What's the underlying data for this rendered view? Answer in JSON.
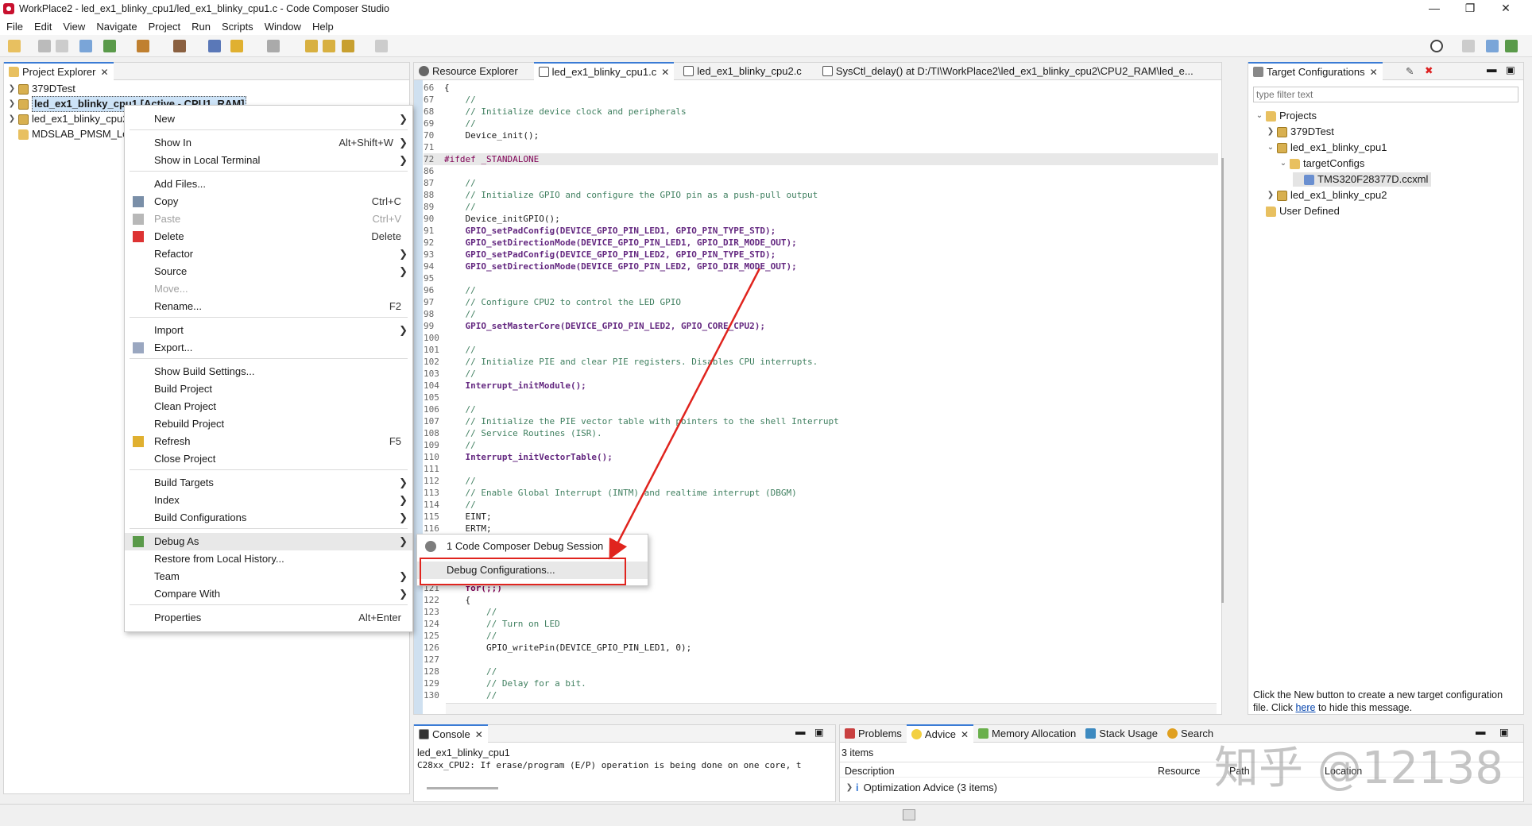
{
  "window": {
    "title": "WorkPlace2 - led_ex1_blinky_cpu1/led_ex1_blinky_cpu1.c - Code Composer Studio",
    "minimize": "—",
    "maximize": "❐",
    "close": "✕"
  },
  "menubar": [
    "File",
    "Edit",
    "View",
    "Navigate",
    "Project",
    "Run",
    "Scripts",
    "Window",
    "Help"
  ],
  "project_explorer": {
    "tab_label": "Project Explorer",
    "items": [
      {
        "label": "379DTest"
      },
      {
        "label": "led_ex1_blinky_cpu1  [Active - CPU1_RAM]"
      },
      {
        "label": "led_ex1_blinky_cpu2"
      },
      {
        "label": "MDSLAB_PMSM_Lo"
      }
    ]
  },
  "context_menu": {
    "items": [
      {
        "label": "New",
        "accel": "",
        "submenu": true
      },
      {
        "label": "Show In",
        "accel": "Alt+Shift+W",
        "submenu": true
      },
      {
        "label": "Show in Local Terminal",
        "accel": "",
        "submenu": true
      },
      {
        "label": "Add Files...",
        "accel": ""
      },
      {
        "label": "Copy",
        "accel": "Ctrl+C"
      },
      {
        "label": "Paste",
        "accel": "Ctrl+V",
        "disabled": true
      },
      {
        "label": "Delete",
        "accel": "Delete"
      },
      {
        "label": "Refactor",
        "accel": "",
        "submenu": true
      },
      {
        "label": "Source",
        "accel": "",
        "submenu": true
      },
      {
        "label": "Move...",
        "accel": "",
        "disabled": true
      },
      {
        "label": "Rename...",
        "accel": "F2"
      },
      {
        "label": "Import",
        "accel": "",
        "submenu": true
      },
      {
        "label": "Export...",
        "accel": ""
      },
      {
        "label": "Show Build Settings...",
        "accel": ""
      },
      {
        "label": "Build Project",
        "accel": ""
      },
      {
        "label": "Clean Project",
        "accel": ""
      },
      {
        "label": "Rebuild Project",
        "accel": ""
      },
      {
        "label": "Refresh",
        "accel": "F5"
      },
      {
        "label": "Close Project",
        "accel": ""
      },
      {
        "label": "Build Targets",
        "accel": "",
        "submenu": true
      },
      {
        "label": "Index",
        "accel": "",
        "submenu": true
      },
      {
        "label": "Build Configurations",
        "accel": "",
        "submenu": true
      },
      {
        "label": "Debug As",
        "accel": "",
        "submenu": true
      },
      {
        "label": "Restore from Local History...",
        "accel": ""
      },
      {
        "label": "Team",
        "accel": "",
        "submenu": true
      },
      {
        "label": "Compare With",
        "accel": "",
        "submenu": true
      },
      {
        "label": "Properties",
        "accel": "Alt+Enter"
      }
    ]
  },
  "debug_submenu": {
    "items": [
      {
        "label": "1 Code Composer Debug Session"
      },
      {
        "label": "Debug Configurations..."
      }
    ]
  },
  "editor": {
    "tabs": [
      {
        "label": "Resource Explorer"
      },
      {
        "label": "led_ex1_blinky_cpu1.c"
      },
      {
        "label": "led_ex1_blinky_cpu2.c"
      },
      {
        "label": "SysCtl_delay() at D:/TI\\WorkPlace2\\led_ex1_blinky_cpu2\\CPU2_RAM\\led_e..."
      }
    ],
    "lines": [
      {
        "n": "66",
        "t": "{"
      },
      {
        "n": "67",
        "t": "    //"
      },
      {
        "n": "68",
        "t": "    // Initialize device clock and peripherals"
      },
      {
        "n": "69",
        "t": "    //"
      },
      {
        "n": "70",
        "t": "    Device_init();"
      },
      {
        "n": "71",
        "t": ""
      },
      {
        "n": "72",
        "t": "#ifdef _STANDALONE"
      },
      {
        "n": "86",
        "t": ""
      },
      {
        "n": "87",
        "t": "    //"
      },
      {
        "n": "88",
        "t": "    // Initialize GPIO and configure the GPIO pin as a push-pull output"
      },
      {
        "n": "89",
        "t": "    //"
      },
      {
        "n": "90",
        "t": "    Device_initGPIO();"
      },
      {
        "n": "91",
        "t": "    GPIO_setPadConfig(DEVICE_GPIO_PIN_LED1, GPIO_PIN_TYPE_STD);"
      },
      {
        "n": "92",
        "t": "    GPIO_setDirectionMode(DEVICE_GPIO_PIN_LED1, GPIO_DIR_MODE_OUT);"
      },
      {
        "n": "93",
        "t": "    GPIO_setPadConfig(DEVICE_GPIO_PIN_LED2, GPIO_PIN_TYPE_STD);"
      },
      {
        "n": "94",
        "t": "    GPIO_setDirectionMode(DEVICE_GPIO_PIN_LED2, GPIO_DIR_MODE_OUT);"
      },
      {
        "n": "95",
        "t": ""
      },
      {
        "n": "96",
        "t": "    //"
      },
      {
        "n": "97",
        "t": "    // Configure CPU2 to control the LED GPIO"
      },
      {
        "n": "98",
        "t": "    //"
      },
      {
        "n": "99",
        "t": "    GPIO_setMasterCore(DEVICE_GPIO_PIN_LED2, GPIO_CORE_CPU2);"
      },
      {
        "n": "100",
        "t": ""
      },
      {
        "n": "101",
        "t": "    //"
      },
      {
        "n": "102",
        "t": "    // Initialize PIE and clear PIE registers. Disables CPU interrupts."
      },
      {
        "n": "103",
        "t": "    //"
      },
      {
        "n": "104",
        "t": "    Interrupt_initModule();"
      },
      {
        "n": "105",
        "t": ""
      },
      {
        "n": "106",
        "t": "    //"
      },
      {
        "n": "107",
        "t": "    // Initialize the PIE vector table with pointers to the shell Interrupt"
      },
      {
        "n": "108",
        "t": "    // Service Routines (ISR)."
      },
      {
        "n": "109",
        "t": "    //"
      },
      {
        "n": "110",
        "t": "    Interrupt_initVectorTable();"
      },
      {
        "n": "111",
        "t": ""
      },
      {
        "n": "112",
        "t": "    //"
      },
      {
        "n": "113",
        "t": "    // Enable Global Interrupt (INTM) and realtime interrupt (DBGM)"
      },
      {
        "n": "114",
        "t": "    //"
      },
      {
        "n": "115",
        "t": "    EINT;"
      },
      {
        "n": "116",
        "t": "    ERTM;"
      },
      {
        "n": "121",
        "t": "    for(;;)"
      },
      {
        "n": "122",
        "t": "    {"
      },
      {
        "n": "123",
        "t": "        //"
      },
      {
        "n": "124",
        "t": "        // Turn on LED"
      },
      {
        "n": "125",
        "t": "        //"
      },
      {
        "n": "126",
        "t": "        GPIO_writePin(DEVICE_GPIO_PIN_LED1, 0);"
      },
      {
        "n": "127",
        "t": ""
      },
      {
        "n": "128",
        "t": "        //"
      },
      {
        "n": "129",
        "t": "        // Delay for a bit."
      },
      {
        "n": "130",
        "t": "        //"
      }
    ]
  },
  "target_configurations": {
    "tab_label": "Target Configurations",
    "filter_placeholder": "type filter text",
    "tree": [
      {
        "label": "Projects"
      },
      {
        "label": "379DTest"
      },
      {
        "label": "led_ex1_blinky_cpu1"
      },
      {
        "label": "targetConfigs"
      },
      {
        "label": "TMS320F28377D.ccxml"
      },
      {
        "label": "led_ex1_blinky_cpu2"
      },
      {
        "label": "User Defined"
      }
    ],
    "hint_line1": "Click the New button to create a new target configuration",
    "hint_line2_pre": "file. Click ",
    "hint_link": "here",
    "hint_line2_post": " to hide this message."
  },
  "console": {
    "tab_label": "Console",
    "project": "led_ex1_blinky_cpu1",
    "message": "C28xx_CPU2: If erase/program (E/P) operation is being done on one core, t"
  },
  "problems_area": {
    "tabs": [
      "Problems",
      "Advice",
      "Memory Allocation",
      "Stack Usage",
      "Search"
    ],
    "count": "3 items",
    "columns": [
      "Description",
      "Resource",
      "Path",
      "Location"
    ],
    "row": "Optimization Advice (3 items)"
  },
  "watermark": "知乎 @12138",
  "colors": {
    "accent": "#3a7bd5",
    "highlight_red": "#e0241e",
    "comment_green": "#3f7f5f",
    "keyword_purple": "#7f0055"
  }
}
